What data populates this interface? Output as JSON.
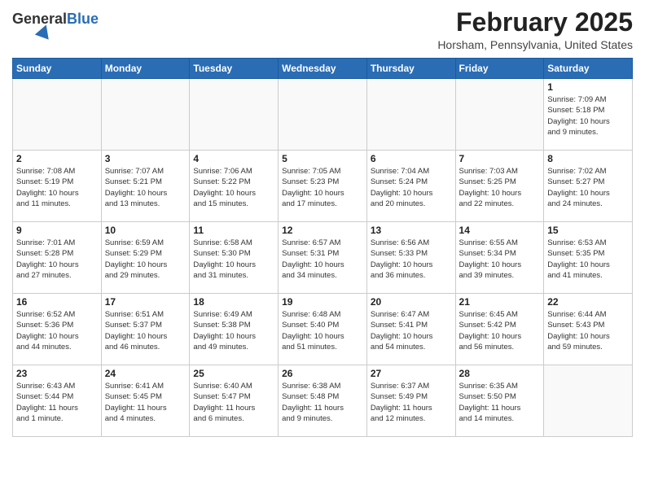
{
  "header": {
    "logo_general": "General",
    "logo_blue": "Blue",
    "title": "February 2025",
    "subtitle": "Horsham, Pennsylvania, United States"
  },
  "days_of_week": [
    "Sunday",
    "Monday",
    "Tuesday",
    "Wednesday",
    "Thursday",
    "Friday",
    "Saturday"
  ],
  "weeks": [
    [
      {
        "day": "",
        "info": ""
      },
      {
        "day": "",
        "info": ""
      },
      {
        "day": "",
        "info": ""
      },
      {
        "day": "",
        "info": ""
      },
      {
        "day": "",
        "info": ""
      },
      {
        "day": "",
        "info": ""
      },
      {
        "day": "1",
        "info": "Sunrise: 7:09 AM\nSunset: 5:18 PM\nDaylight: 10 hours\nand 9 minutes."
      }
    ],
    [
      {
        "day": "2",
        "info": "Sunrise: 7:08 AM\nSunset: 5:19 PM\nDaylight: 10 hours\nand 11 minutes."
      },
      {
        "day": "3",
        "info": "Sunrise: 7:07 AM\nSunset: 5:21 PM\nDaylight: 10 hours\nand 13 minutes."
      },
      {
        "day": "4",
        "info": "Sunrise: 7:06 AM\nSunset: 5:22 PM\nDaylight: 10 hours\nand 15 minutes."
      },
      {
        "day": "5",
        "info": "Sunrise: 7:05 AM\nSunset: 5:23 PM\nDaylight: 10 hours\nand 17 minutes."
      },
      {
        "day": "6",
        "info": "Sunrise: 7:04 AM\nSunset: 5:24 PM\nDaylight: 10 hours\nand 20 minutes."
      },
      {
        "day": "7",
        "info": "Sunrise: 7:03 AM\nSunset: 5:25 PM\nDaylight: 10 hours\nand 22 minutes."
      },
      {
        "day": "8",
        "info": "Sunrise: 7:02 AM\nSunset: 5:27 PM\nDaylight: 10 hours\nand 24 minutes."
      }
    ],
    [
      {
        "day": "9",
        "info": "Sunrise: 7:01 AM\nSunset: 5:28 PM\nDaylight: 10 hours\nand 27 minutes."
      },
      {
        "day": "10",
        "info": "Sunrise: 6:59 AM\nSunset: 5:29 PM\nDaylight: 10 hours\nand 29 minutes."
      },
      {
        "day": "11",
        "info": "Sunrise: 6:58 AM\nSunset: 5:30 PM\nDaylight: 10 hours\nand 31 minutes."
      },
      {
        "day": "12",
        "info": "Sunrise: 6:57 AM\nSunset: 5:31 PM\nDaylight: 10 hours\nand 34 minutes."
      },
      {
        "day": "13",
        "info": "Sunrise: 6:56 AM\nSunset: 5:33 PM\nDaylight: 10 hours\nand 36 minutes."
      },
      {
        "day": "14",
        "info": "Sunrise: 6:55 AM\nSunset: 5:34 PM\nDaylight: 10 hours\nand 39 minutes."
      },
      {
        "day": "15",
        "info": "Sunrise: 6:53 AM\nSunset: 5:35 PM\nDaylight: 10 hours\nand 41 minutes."
      }
    ],
    [
      {
        "day": "16",
        "info": "Sunrise: 6:52 AM\nSunset: 5:36 PM\nDaylight: 10 hours\nand 44 minutes."
      },
      {
        "day": "17",
        "info": "Sunrise: 6:51 AM\nSunset: 5:37 PM\nDaylight: 10 hours\nand 46 minutes."
      },
      {
        "day": "18",
        "info": "Sunrise: 6:49 AM\nSunset: 5:38 PM\nDaylight: 10 hours\nand 49 minutes."
      },
      {
        "day": "19",
        "info": "Sunrise: 6:48 AM\nSunset: 5:40 PM\nDaylight: 10 hours\nand 51 minutes."
      },
      {
        "day": "20",
        "info": "Sunrise: 6:47 AM\nSunset: 5:41 PM\nDaylight: 10 hours\nand 54 minutes."
      },
      {
        "day": "21",
        "info": "Sunrise: 6:45 AM\nSunset: 5:42 PM\nDaylight: 10 hours\nand 56 minutes."
      },
      {
        "day": "22",
        "info": "Sunrise: 6:44 AM\nSunset: 5:43 PM\nDaylight: 10 hours\nand 59 minutes."
      }
    ],
    [
      {
        "day": "23",
        "info": "Sunrise: 6:43 AM\nSunset: 5:44 PM\nDaylight: 11 hours\nand 1 minute."
      },
      {
        "day": "24",
        "info": "Sunrise: 6:41 AM\nSunset: 5:45 PM\nDaylight: 11 hours\nand 4 minutes."
      },
      {
        "day": "25",
        "info": "Sunrise: 6:40 AM\nSunset: 5:47 PM\nDaylight: 11 hours\nand 6 minutes."
      },
      {
        "day": "26",
        "info": "Sunrise: 6:38 AM\nSunset: 5:48 PM\nDaylight: 11 hours\nand 9 minutes."
      },
      {
        "day": "27",
        "info": "Sunrise: 6:37 AM\nSunset: 5:49 PM\nDaylight: 11 hours\nand 12 minutes."
      },
      {
        "day": "28",
        "info": "Sunrise: 6:35 AM\nSunset: 5:50 PM\nDaylight: 11 hours\nand 14 minutes."
      },
      {
        "day": "",
        "info": ""
      }
    ]
  ]
}
